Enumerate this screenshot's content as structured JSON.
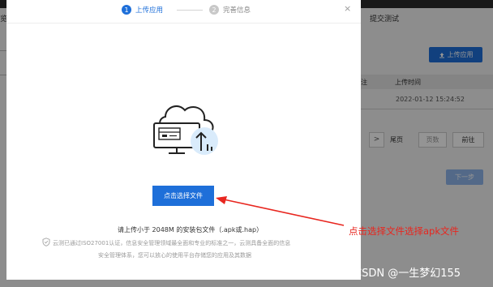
{
  "background_page": {
    "tab_label": "提交测试",
    "tab_label_left": "览",
    "upload_button_label": "上传应用",
    "table": {
      "headers": [
        "注",
        "上传时间"
      ],
      "row_time": "2022-01-12 15:24:52"
    },
    "pagination": {
      "next_arrow": ">",
      "page_unit": "尾页",
      "page_input_placeholder": "页数",
      "goto_label": "前往"
    },
    "next_step_label": "下一步"
  },
  "dialog": {
    "steps": [
      {
        "number": "1",
        "label": "上传应用",
        "state": "active"
      },
      {
        "number": "2",
        "label": "完善信息",
        "state": "pending"
      }
    ],
    "close_glyph": "×",
    "choose_file_button": "点击选择文件",
    "hint": "请上传小于 2048M 的安装包文件（.apk或.hap）",
    "security_note_line1": "云测已通过ISO27001认证，信息安全管理领域最全面和专业的标准之一，云测具备全面的信息",
    "security_note_line2": "安全管理体系，您可以放心的使用平台存储您的应用及其数据"
  },
  "annotation": {
    "text": "点击选择文件选择apk文件",
    "color": "#e8261f"
  },
  "watermark": "CSDN @一生梦幻155",
  "colors": {
    "primary": "#1e6fd9",
    "annotation_red": "#e8261f"
  }
}
